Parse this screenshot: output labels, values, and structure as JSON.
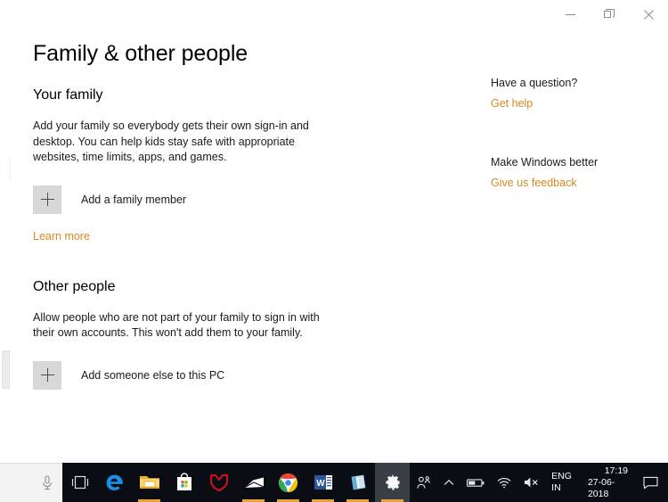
{
  "window": {
    "title": "Family & other people",
    "caption_buttons": [
      {
        "name": "minimize",
        "label": "–"
      },
      {
        "name": "restore",
        "label": "❐"
      },
      {
        "name": "close",
        "label": "✕"
      }
    ]
  },
  "main": {
    "page_title": "Family & other people",
    "sections": [
      {
        "heading": "Your family",
        "description": "Add your family so everybody gets their own sign-in and desktop. You can help kids stay safe with appropriate websites, time limits, apps, and games.",
        "action_label": "Add a family member",
        "link_label": "Learn more"
      },
      {
        "heading": "Other people",
        "description": "Allow people who are not part of your family to sign in with their own accounts. This won't add them to your family.",
        "action_label": "Add someone else to this PC",
        "link_label": ""
      }
    ]
  },
  "sidebar": {
    "groups": [
      {
        "heading": "Have a question?",
        "link": "Get help"
      },
      {
        "heading": "Make Windows better",
        "link": "Give us feedback"
      }
    ]
  },
  "taskbar": {
    "search_placeholder": "",
    "search_icon": "microphone-icon",
    "apps": [
      {
        "name": "task-view",
        "icon": "task-view-icon",
        "running": false
      },
      {
        "name": "microsoft-edge",
        "icon": "edge-icon",
        "running": false
      },
      {
        "name": "file-explorer",
        "icon": "folder-icon",
        "running": true
      },
      {
        "name": "microsoft-store",
        "icon": "store-bag-icon",
        "running": false
      },
      {
        "name": "mcafee",
        "icon": "mcafee-shield-icon",
        "running": false
      },
      {
        "name": "mail",
        "icon": "mail-envelope-icon",
        "running": true
      },
      {
        "name": "google-chrome",
        "icon": "chrome-icon",
        "running": true
      },
      {
        "name": "microsoft-word",
        "icon": "word-icon",
        "running": true
      },
      {
        "name": "onenote",
        "icon": "onenote-icon",
        "running": true
      },
      {
        "name": "settings",
        "icon": "gear-icon",
        "running": true
      }
    ],
    "tray": {
      "people_icon": "people-icon",
      "chevron_icon": "chevron-up-icon",
      "battery_icon": "battery-icon",
      "network_icon": "wifi-icon",
      "volume_icon": "speaker-muted-icon",
      "language_line1": "ENG",
      "language_line2": "IN",
      "time": "17:19",
      "date": "27-06-2018",
      "action_center_icon": "notification-icon"
    }
  },
  "colors": {
    "accent_link": "#d9891f",
    "taskbar_bg": "#0a0d14",
    "running_underline": "#e8a33d",
    "plus_box": "#d8d8d8"
  }
}
